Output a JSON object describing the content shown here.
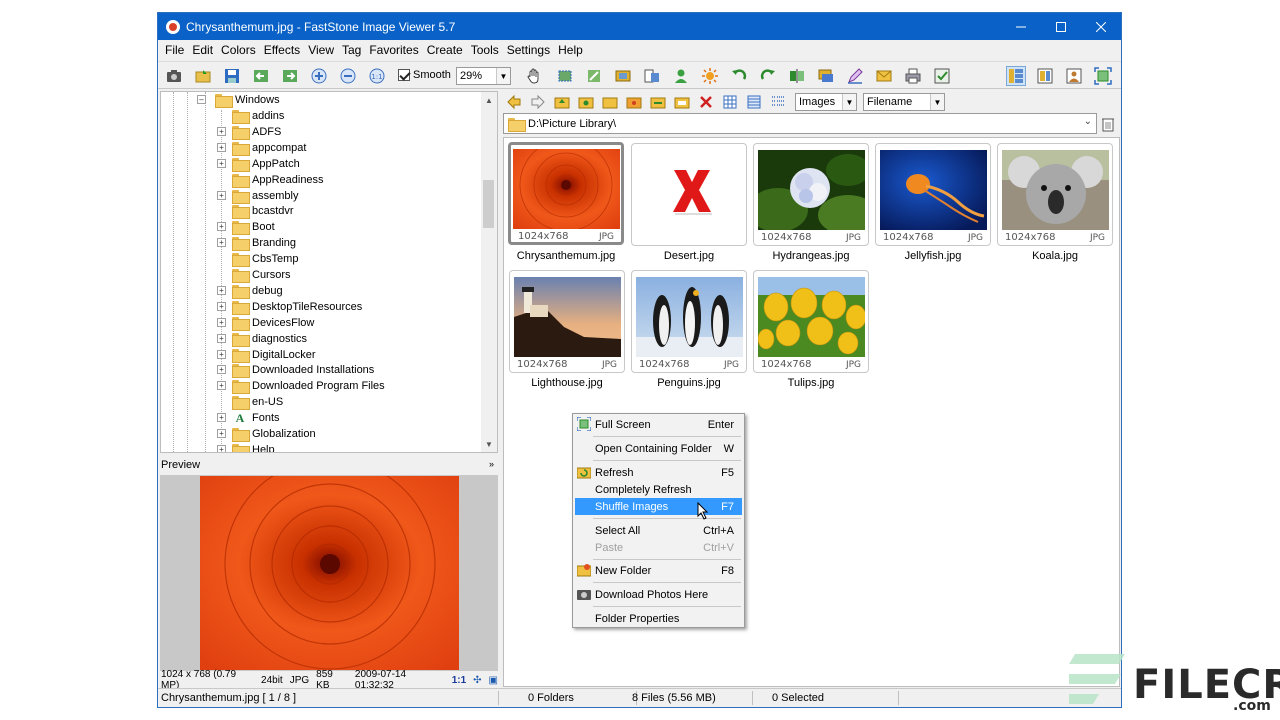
{
  "window": {
    "title": "Chrysanthemum.jpg  -  FastStone Image Viewer 5.7"
  },
  "menu": [
    "File",
    "Edit",
    "Colors",
    "Effects",
    "View",
    "Tag",
    "Favorites",
    "Create",
    "Tools",
    "Settings",
    "Help"
  ],
  "toolbar": {
    "smooth_label": "Smooth",
    "zoom_value": "29%"
  },
  "tree": {
    "root": "Windows",
    "items": [
      "addins",
      "ADFS",
      "appcompat",
      "AppPatch",
      "AppReadiness",
      "assembly",
      "bcastdvr",
      "Boot",
      "Branding",
      "CbsTemp",
      "Cursors",
      "debug",
      "DesktopTileResources",
      "DevicesFlow",
      "diagnostics",
      "DigitalLocker",
      "Downloaded Installations",
      "Downloaded Program Files",
      "en-US",
      "Fonts",
      "Globalization",
      "Help"
    ]
  },
  "preview": {
    "header": "Preview",
    "info": {
      "dims": "1024 x 768 (0.79 MP)",
      "depth": "24bit",
      "format": "JPG",
      "size": "859 KB",
      "date": "2009-07-14 01:32:32",
      "ratio": "1:1"
    }
  },
  "browser": {
    "filter_value": "Images",
    "sort_value": "Filename",
    "path": "D:\\Picture Library\\"
  },
  "thumbnails": [
    {
      "name": "Chrysanthemum.jpg",
      "size": "1024x768",
      "ext": "JPG",
      "selected": true
    },
    {
      "name": "Desert.jpg",
      "size": "",
      "ext": "",
      "missing": true
    },
    {
      "name": "Hydrangeas.jpg",
      "size": "1024x768",
      "ext": "JPG"
    },
    {
      "name": "Jellyfish.jpg",
      "size": "1024x768",
      "ext": "JPG"
    },
    {
      "name": "Koala.jpg",
      "size": "1024x768",
      "ext": "JPG"
    },
    {
      "name": "Lighthouse.jpg",
      "size": "1024x768",
      "ext": "JPG"
    },
    {
      "name": "Penguins.jpg",
      "size": "1024x768",
      "ext": "JPG"
    },
    {
      "name": "Tulips.jpg",
      "size": "1024x768",
      "ext": "JPG"
    }
  ],
  "context_menu": [
    {
      "label": "Full Screen",
      "key": "Enter",
      "icon": "fullscreen-icon"
    },
    {
      "label": "Open Containing Folder",
      "key": "W"
    },
    {
      "label": "Refresh",
      "key": "F5",
      "icon": "refresh-icon"
    },
    {
      "label": "Completely Refresh",
      "key": ""
    },
    {
      "label": "Shuffle Images",
      "key": "F7",
      "highlighted": true
    },
    {
      "label": "Select All",
      "key": "Ctrl+A"
    },
    {
      "label": "Paste",
      "key": "Ctrl+V",
      "disabled": true
    },
    {
      "label": "New Folder",
      "key": "F8",
      "icon": "new-folder-icon"
    },
    {
      "label": "Download Photos Here",
      "key": "",
      "icon": "camera-icon"
    },
    {
      "label": "Folder Properties",
      "key": ""
    }
  ],
  "status": {
    "current": "Chrysanthemum.jpg [ 1 / 8 ]",
    "folders": "0 Folders",
    "files": "8 Files (5.56 MB)",
    "selected": "0 Selected"
  },
  "watermark": {
    "brand": "FILECR",
    "suffix": ".com"
  },
  "colors": {
    "titlebar": "#0a62c8",
    "highlight": "#3399ff",
    "folder": "#f5cf6a"
  }
}
